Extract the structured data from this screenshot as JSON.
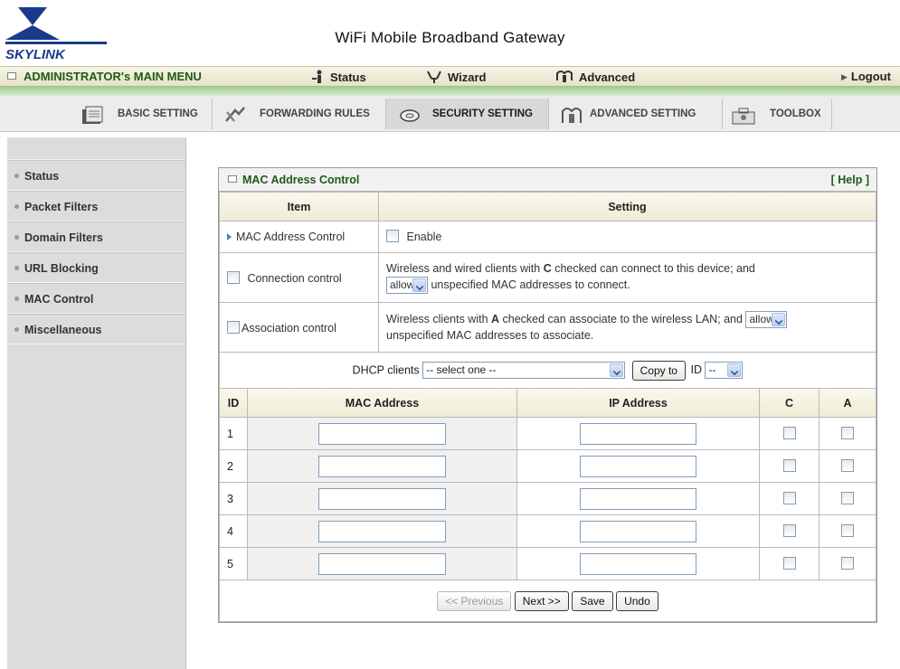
{
  "header": {
    "brand": "SKYLINK",
    "title": "WiFi Mobile Broadband Gateway"
  },
  "topmenu": {
    "admin": "ADMINISTRATOR's MAIN MENU",
    "status": "Status",
    "wizard": "Wizard",
    "advanced": "Advanced",
    "logout": "Logout"
  },
  "tabs": [
    {
      "label": "BASIC SETTING",
      "icon": "folder-icon"
    },
    {
      "label": "FORWARDING RULES",
      "icon": "arrows-icon"
    },
    {
      "label": "SECURITY SETTING",
      "icon": "disk-icon"
    },
    {
      "label": "ADVANCED SETTING",
      "icon": "gear-icon"
    },
    {
      "label": "TOOLBOX",
      "icon": "toolbox-icon"
    }
  ],
  "active_tab": "SECURITY SETTING",
  "sidebar": {
    "items": [
      {
        "label": "Status"
      },
      {
        "label": "Packet Filters"
      },
      {
        "label": "Domain Filters"
      },
      {
        "label": "URL Blocking"
      },
      {
        "label": "MAC Control"
      },
      {
        "label": "Miscellaneous"
      }
    ]
  },
  "panel": {
    "title": "MAC Address Control",
    "help": "[ Help ]",
    "col_item": "Item",
    "col_setting": "Setting",
    "mac_control_label": "MAC Address Control",
    "enable_label": "Enable",
    "conn_label": "Connection control",
    "conn_text_1": "Wireless and wired clients with",
    "conn_bold": "C",
    "conn_text_2": "checked can connect to this device; and",
    "conn_select": "allow",
    "conn_text_3": "unspecified MAC addresses to connect.",
    "assoc_label": "Association control",
    "assoc_text_1": "Wireless clients with",
    "assoc_bold": "A",
    "assoc_text_2": "checked can associate to the wireless LAN; and",
    "assoc_select": "allow",
    "assoc_text_3": "unspecified MAC addresses to associate.",
    "dhcp_label": "DHCP clients",
    "dhcp_select": "-- select one --",
    "copy_to": "Copy to",
    "id_label": "ID",
    "id_select": "--",
    "table_headers": [
      "ID",
      "MAC Address",
      "IP Address",
      "C",
      "A"
    ],
    "rows": [
      "1",
      "2",
      "3",
      "4",
      "5"
    ],
    "btn_previous": "<< Previous",
    "btn_next": "Next >>",
    "btn_save": "Save",
    "btn_undo": "Undo"
  },
  "colors": {
    "accent_green": "#1f5a19",
    "menu_bar": "#e9e6cb",
    "green_strip": "#9ecf8c"
  }
}
